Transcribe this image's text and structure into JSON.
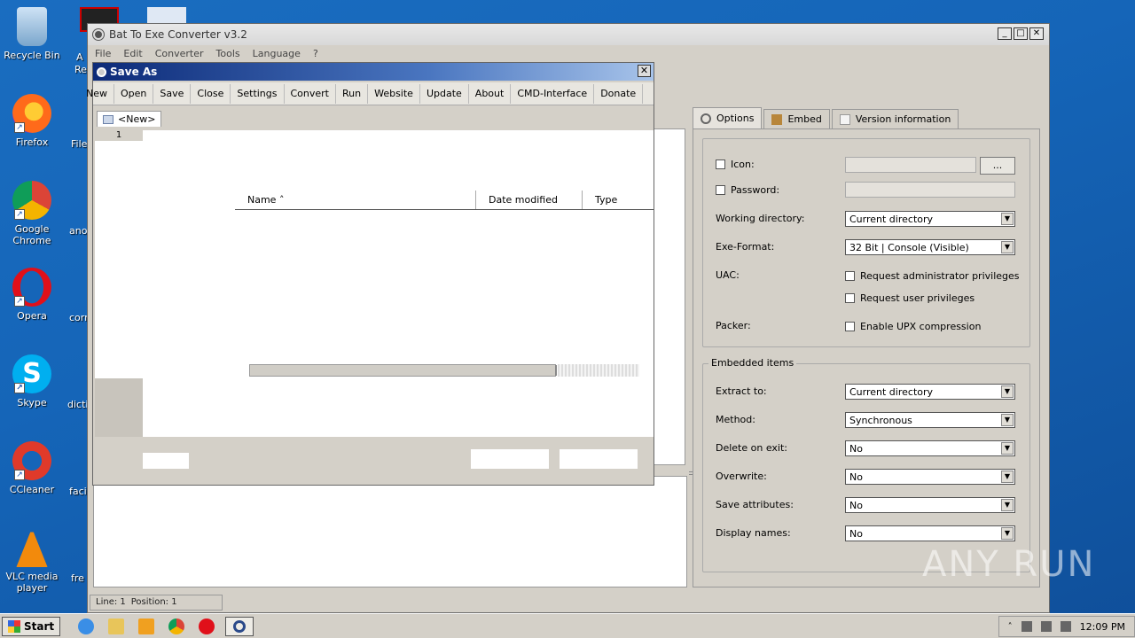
{
  "desktop": {
    "icons": [
      {
        "label": "Recycle Bin"
      },
      {
        "label": "Firefox"
      },
      {
        "label": "Google Chrome"
      },
      {
        "label": "Opera"
      },
      {
        "label": "Skype"
      },
      {
        "label": "CCleaner"
      },
      {
        "label": "VLC media player"
      }
    ],
    "partial_labels": [
      "A",
      "Re",
      "File",
      "ano",
      "corr",
      "dicti",
      "faci",
      "fre"
    ]
  },
  "main_window": {
    "title": "Bat To Exe Converter v3.2",
    "menu": [
      "File",
      "Edit",
      "Converter",
      "Tools",
      "Language",
      "?"
    ],
    "status": {
      "line": "Line: 1",
      "position": "Position: 1"
    }
  },
  "right_panel": {
    "tabs": [
      "Options",
      "Embed",
      "Version information"
    ],
    "icon_label": "Icon:",
    "icon_browse": "...",
    "password_label": "Password:",
    "working_dir_label": "Working directory:",
    "working_dir_value": "Current directory",
    "exe_format_label": "Exe-Format:",
    "exe_format_value": "32 Bit | Console (Visible)",
    "uac_label": "UAC:",
    "uac_admin": "Request administrator privileges",
    "uac_user": "Request user privileges",
    "packer_label": "Packer:",
    "packer_upx": "Enable UPX compression",
    "embedded_title": "Embedded items",
    "extract_label": "Extract to:",
    "extract_value": "Current directory",
    "method_label": "Method:",
    "method_value": "Synchronous",
    "delete_label": "Delete on exit:",
    "delete_value": "No",
    "overwrite_label": "Overwrite:",
    "overwrite_value": "No",
    "save_attr_label": "Save attributes:",
    "save_attr_value": "No",
    "display_names_label": "Display names:",
    "display_names_value": "No"
  },
  "dialog": {
    "title": "Save As",
    "close": "✕",
    "toolbar": [
      "New",
      "Open",
      "Save",
      "Close",
      "Settings",
      "Convert",
      "Run",
      "Website",
      "Update",
      "About",
      "CMD-Interface",
      "Donate"
    ],
    "doc_tab": "<New>",
    "line_number": "1",
    "columns": [
      "Name",
      "Date modified",
      "Type"
    ]
  },
  "taskbar": {
    "start": "Start",
    "clock": "12:09 PM"
  },
  "watermark": "ANY RUN"
}
